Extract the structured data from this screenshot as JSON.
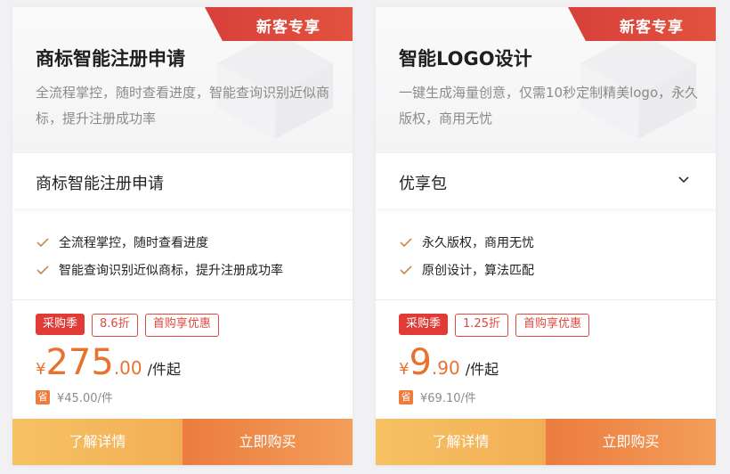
{
  "cards": [
    {
      "badge": "新客专享",
      "title": "商标智能注册申请",
      "desc": "全流程掌控，随时查看进度，智能查询识别近似商标，提升注册成功率",
      "select_value": "商标智能注册申请",
      "features": [
        "全流程掌控，随时查看进度",
        "智能查询识别近似商标，提升注册成功率"
      ],
      "tags": [
        "采购季",
        "8.6折",
        "首购享优惠"
      ],
      "price": {
        "symbol": "¥",
        "integer": "275",
        "decimal": ".00",
        "unit": "/件起"
      },
      "save": {
        "icon_label": "省",
        "text": "¥45.00/件"
      },
      "buttons": {
        "detail": "了解详情",
        "buy": "立即购买"
      }
    },
    {
      "badge": "新客专享",
      "title": "智能LOGO设计",
      "desc": "一键生成海量创意，仅需10秒定制精美logo，永久版权，商用无忧",
      "select_value": "优享包",
      "features": [
        "永久版权，商用无忧",
        "原创设计，算法匹配"
      ],
      "tags": [
        "采购季",
        "1.25折",
        "首购享优惠"
      ],
      "price": {
        "symbol": "¥",
        "integer": "9",
        "decimal": ".90",
        "unit": "/件起"
      },
      "save": {
        "icon_label": "省",
        "text": "¥69.10/件"
      },
      "buttons": {
        "detail": "了解详情",
        "buy": "立即购买"
      }
    }
  ],
  "icons": {
    "check": "check-icon",
    "dropdown": "chevron-down-icon",
    "save": "save-icon"
  },
  "colors": {
    "accent": "#e8722f",
    "ribbon": "#d8403a",
    "tag_red": "#e03c35",
    "detail_btn": "#f4b85d",
    "buy_btn": "#ee8846"
  }
}
